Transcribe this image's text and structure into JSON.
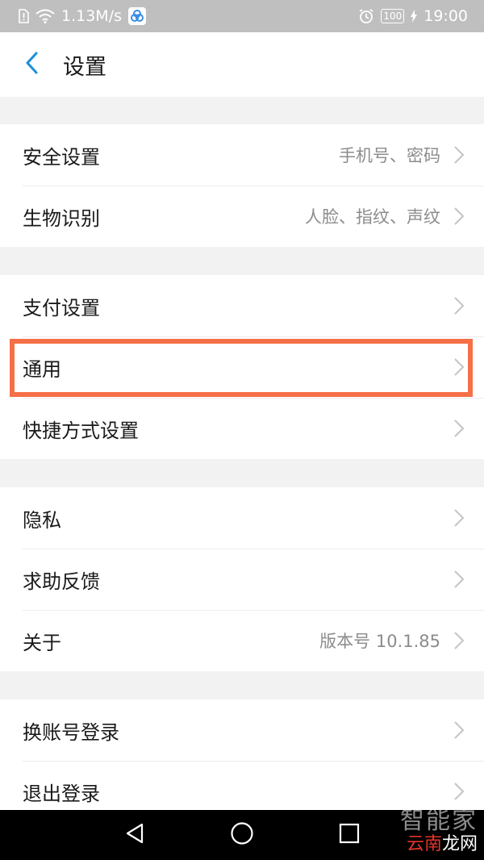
{
  "status_bar": {
    "speed": "1.13M/s",
    "battery": "100",
    "time": "19:00"
  },
  "header": {
    "title": "设置"
  },
  "groups": [
    {
      "items": [
        {
          "label": "安全设置",
          "value": "手机号、密码"
        },
        {
          "label": "生物识别",
          "value": "人脸、指纹、声纹"
        }
      ]
    },
    {
      "items": [
        {
          "label": "支付设置"
        },
        {
          "label": "通用"
        },
        {
          "label": "快捷方式设置"
        }
      ]
    },
    {
      "items": [
        {
          "label": "隐私"
        },
        {
          "label": "求助反馈"
        },
        {
          "label": "关于",
          "value": "版本号 10.1.85"
        }
      ]
    },
    {
      "items": [
        {
          "label": "换账号登录"
        },
        {
          "label": "退出登录"
        }
      ]
    }
  ],
  "watermark": {
    "top": "智能家",
    "red": "云南",
    "white": "龙网"
  },
  "colors": {
    "accent": "#1a8fd8",
    "highlight": "#f56f47",
    "status_bar": "#bfbfbf",
    "background": "#f2f2f2"
  },
  "icons": {
    "back": "chevron-left-icon",
    "row_arrow": "chevron-right-icon",
    "nav_back": "triangle-back-icon",
    "nav_home": "circle-home-icon",
    "nav_recent": "square-recent-icon"
  }
}
